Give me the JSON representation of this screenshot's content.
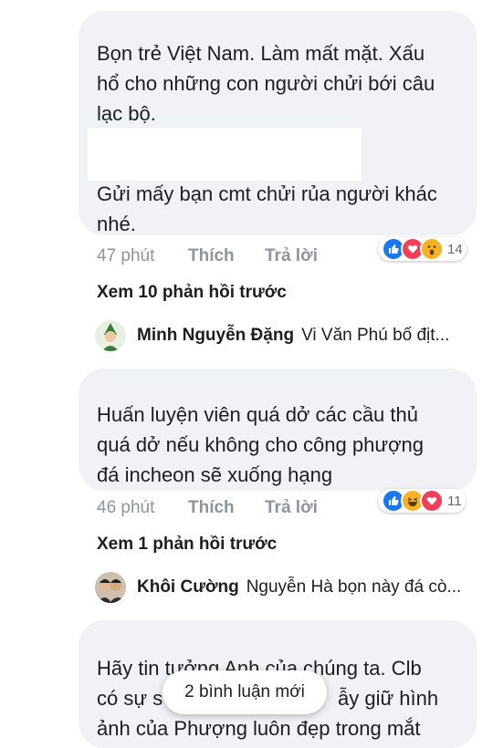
{
  "comments": [
    {
      "lines_a": [
        "Bọn trẻ Việt Nam. Làm mất mặt. Xấu",
        "hổ cho những con người chửi bới câu",
        "lạc bộ."
      ],
      "lines_b": [
        "Gửi mấy bạn cmt chửi rủa người khác",
        "nhé."
      ],
      "time": "47 phút",
      "like_label": "Thích",
      "reply_label": "Trả lời",
      "reactions": [
        "like-icon",
        "love-icon",
        "wow-icon"
      ],
      "reaction_count": "14",
      "previous_replies": "Xem 10 phản hồi trước",
      "reply": {
        "name": "Minh Nguyễn Đặng",
        "text": "Vi Văn Phú  bố địt..."
      }
    },
    {
      "lines": [
        "Huấn luyện viên quá dở các cầu thủ",
        "quá dở nếu không cho công phượng",
        "đá incheon sẽ xuống hạng"
      ],
      "time": "46 phút",
      "like_label": "Thích",
      "reply_label": "Trả lời",
      "reactions": [
        "like-icon",
        "haha-icon",
        "love-icon"
      ],
      "reaction_count": "11",
      "previous_replies": "Xem 1 phản hồi trước",
      "reply": {
        "name": "Khôi Cường",
        "text": "Nguyễn Hà bọn này đá cò..."
      }
    },
    {
      "lines": [
        "Hãy tin tưởng Anh của chúng ta. Clb",
        "có sự s",
        "ẫy giữ hình",
        "ảnh của Phượng luôn đẹp trong mắt"
      ]
    }
  ],
  "new_comments_pill": "2 bình luận mới",
  "colors": {
    "bubble": "#f0f2f5",
    "meta": "#8d949e",
    "like": "#1877f2",
    "love": "#f33e58",
    "haha": "#f7b125"
  }
}
